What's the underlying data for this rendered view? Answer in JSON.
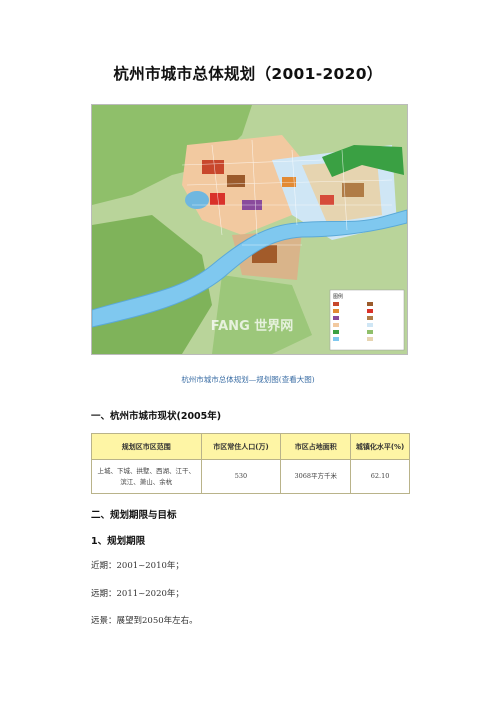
{
  "title": "杭州市城市总体规划（2001-2020）",
  "map": {
    "legend_title": "图例",
    "watermark": "FANG 世界网"
  },
  "caption": "杭州市城市总体规划—规划图(查看大图)",
  "section1": {
    "heading": "一、杭州市城市现状(2005年)",
    "table": {
      "headers": [
        "规划区市区范围",
        "市区常住人口(万)",
        "市区占地面积",
        "城镇化水平(%)"
      ],
      "row": {
        "area_line1": "上城、下城、拱墅、西湖、江干、",
        "area_line2": "滨江、萧山、余杭",
        "population": "530",
        "land": "3068平方千米",
        "urbanization": "62.10"
      }
    }
  },
  "section2": {
    "heading": "二、规划期限与目标",
    "sub_heading": "1、规划期限",
    "lines": [
      "近期：2001~2010年；",
      "远期：2011~2020年；",
      "远景：展望到2050年左右。"
    ]
  }
}
